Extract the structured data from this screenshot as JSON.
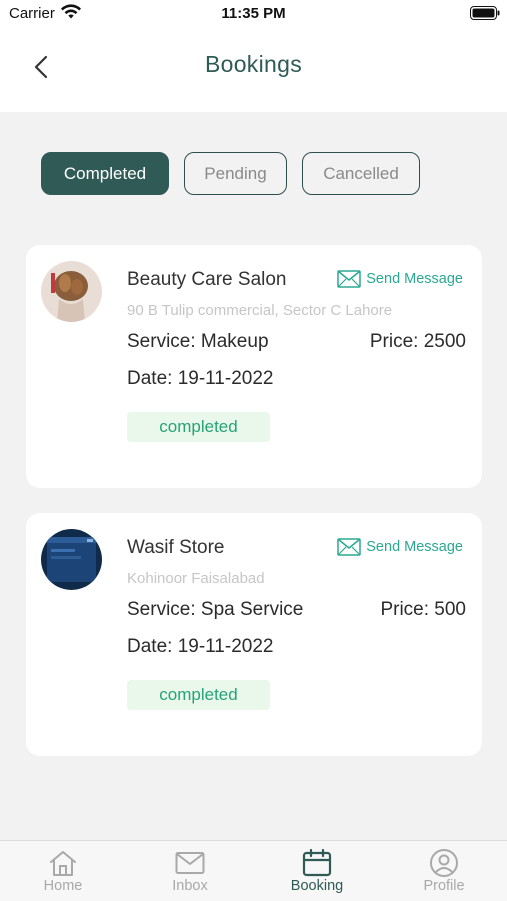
{
  "status_bar": {
    "carrier": "Carrier",
    "time": "11:35 PM"
  },
  "header": {
    "title": "Bookings"
  },
  "filters": [
    {
      "label": "Completed",
      "active": true
    },
    {
      "label": "Pending",
      "active": false
    },
    {
      "label": "Cancelled",
      "active": false
    }
  ],
  "bookings": [
    {
      "shop_name": "Beauty Care Salon",
      "address": "90 B Tulip commercial, Sector C Lahore",
      "service": "Service: Makeup",
      "price": "Price: 2500",
      "date": "Date: 19-11-2022",
      "status": "completed",
      "send_message": "Send Message"
    },
    {
      "shop_name": "Wasif Store",
      "address": "Kohinoor Faisalabad",
      "service": "Service: Spa Service",
      "price": "Price: 500",
      "date": "Date: 19-11-2022",
      "status": "completed",
      "send_message": "Send Message"
    }
  ],
  "tabbar": [
    {
      "label": "Home",
      "icon": "home-icon",
      "active": false
    },
    {
      "label": "Inbox",
      "icon": "mail-icon",
      "active": false
    },
    {
      "label": "Booking",
      "icon": "calendar-icon",
      "active": true
    },
    {
      "label": "Profile",
      "icon": "user-icon",
      "active": false
    }
  ],
  "colors": {
    "primary": "#2f5a55",
    "accent": "#2aa892",
    "badge_bg": "#e9f8ea",
    "badge_text": "#27a37a",
    "background": "#f2f2f2"
  }
}
